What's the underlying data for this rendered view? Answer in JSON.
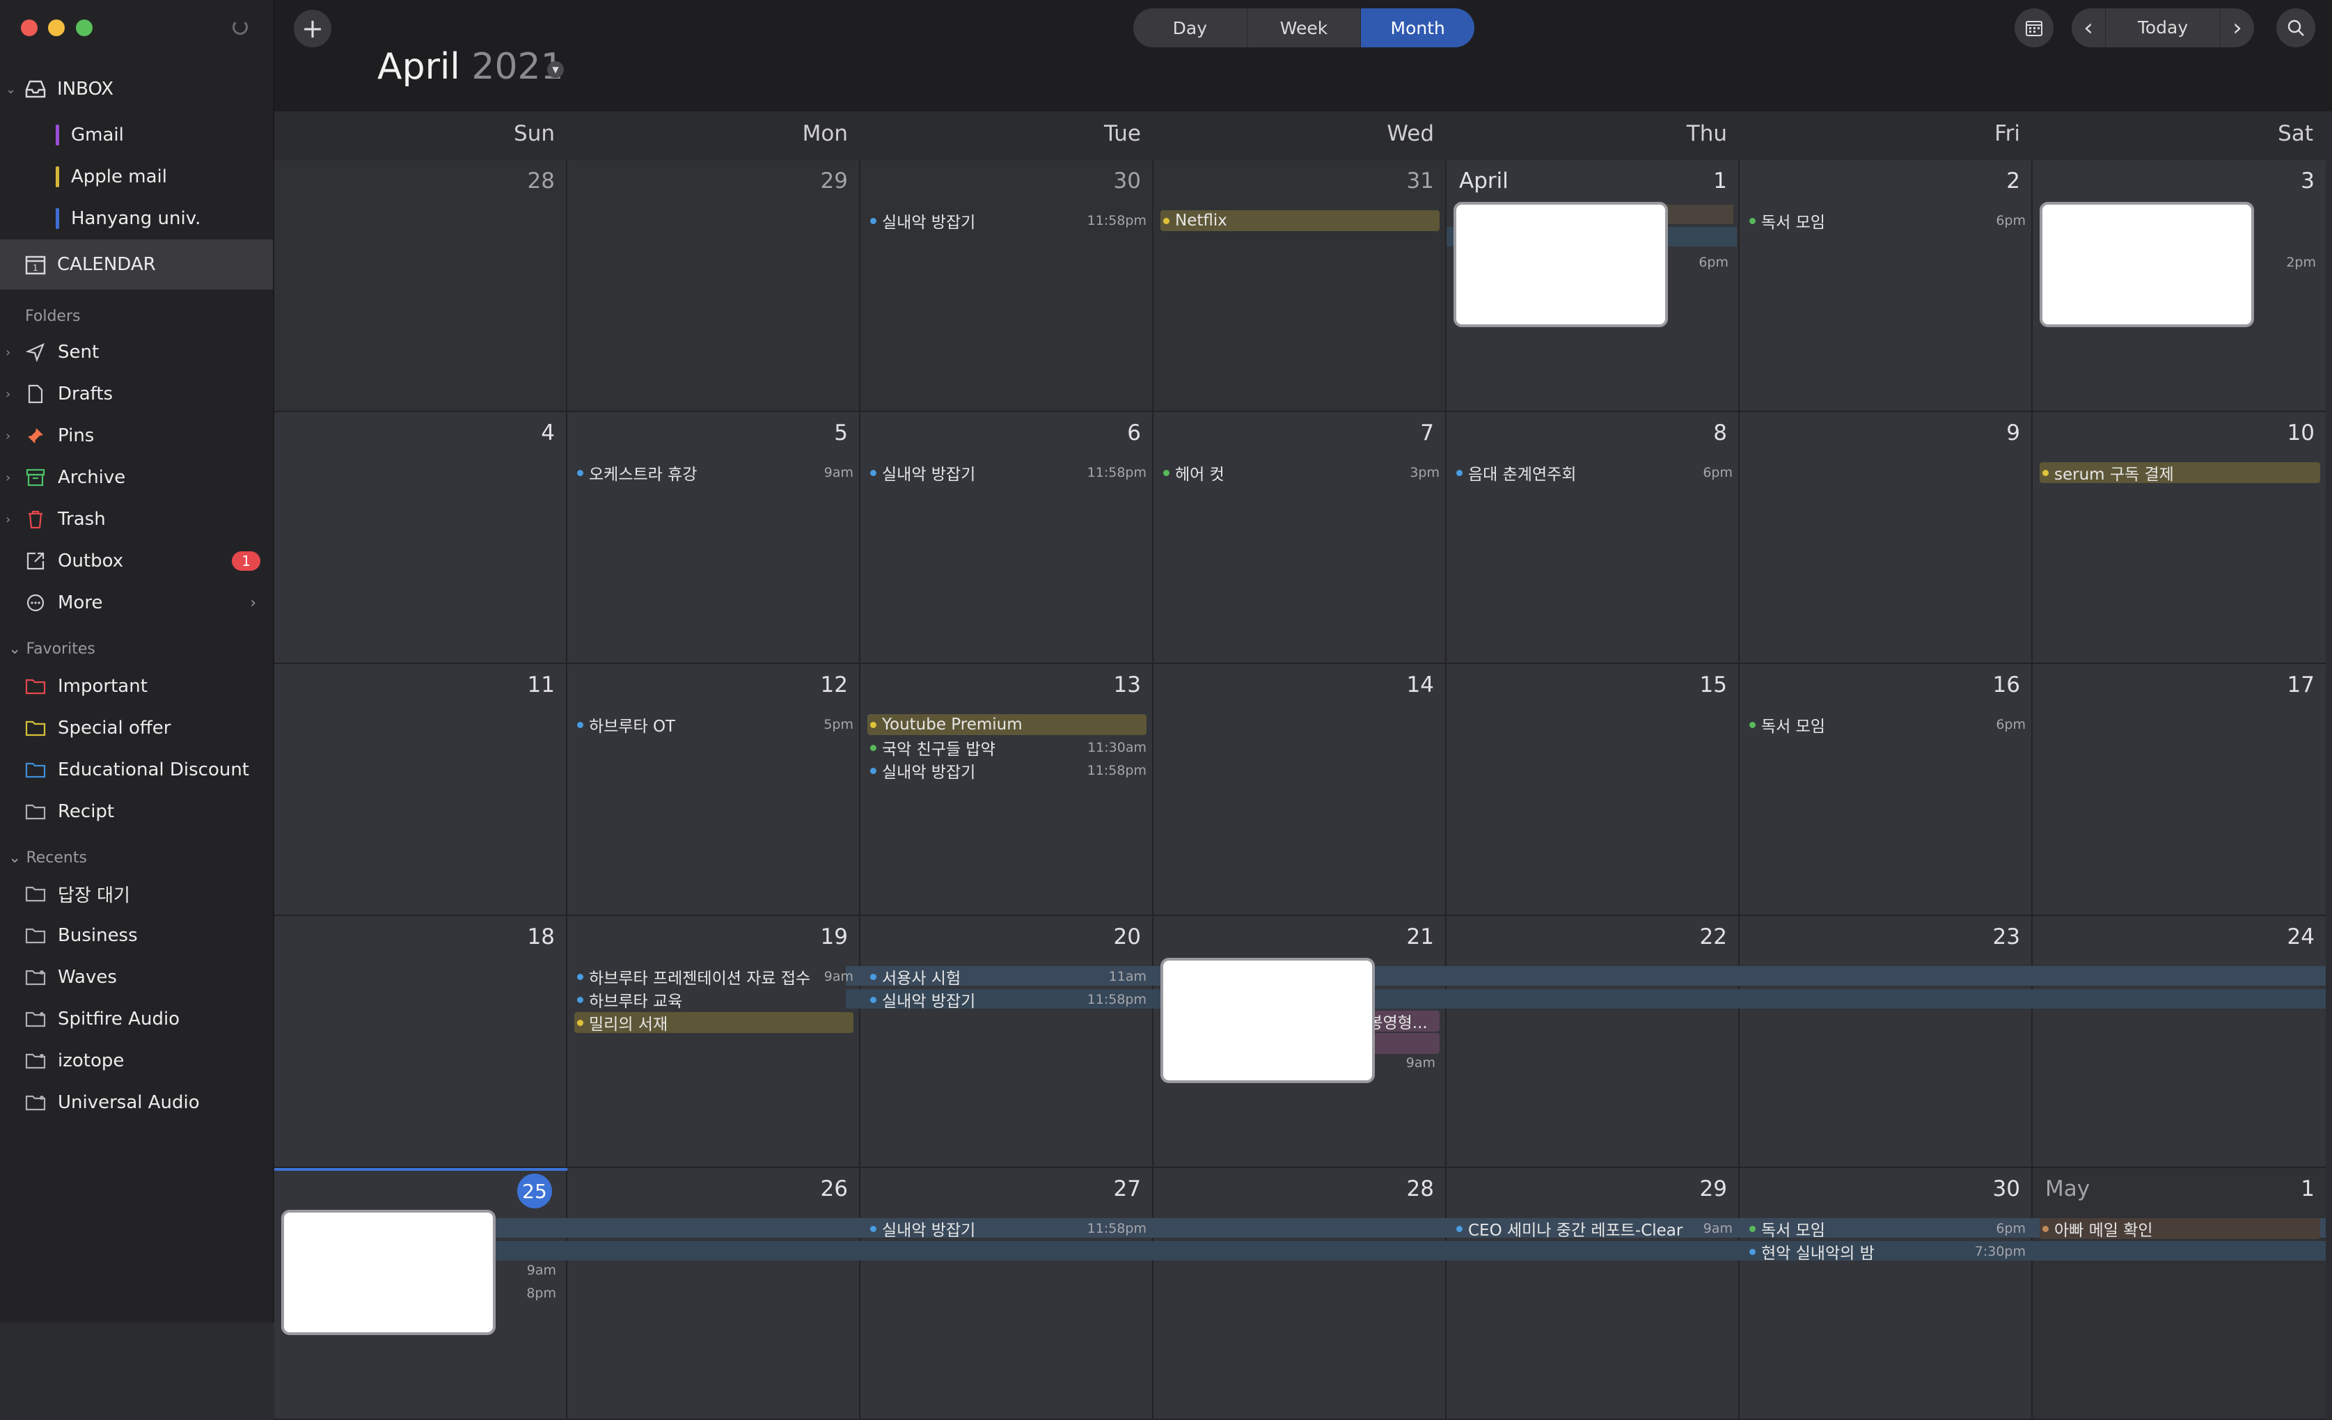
{
  "sidebar": {
    "inbox_label": "INBOX",
    "accounts": [
      {
        "label": "Gmail",
        "color": "#9b4fd6"
      },
      {
        "label": "Apple mail",
        "color": "#d6b73a"
      },
      {
        "label": "Hanyang univ.",
        "color": "#3f6fd6"
      }
    ],
    "calendar_label": "CALENDAR",
    "folders_header": "Folders",
    "folders": [
      {
        "label": "Sent",
        "icon": "paper-plane-icon"
      },
      {
        "label": "Drafts",
        "icon": "draft-document-icon"
      },
      {
        "label": "Pins",
        "icon": "pin-icon"
      },
      {
        "label": "Archive",
        "icon": "archive-box-icon"
      },
      {
        "label": "Trash",
        "icon": "trash-icon"
      },
      {
        "label": "Outbox",
        "icon": "outbox-icon",
        "badge": "1"
      },
      {
        "label": "More",
        "icon": "ellipsis-circle-icon"
      }
    ],
    "favorites_header": "Favorites",
    "favorites": [
      {
        "label": "Important",
        "color": "#e5484d"
      },
      {
        "label": "Special offer",
        "color": "#d6c23a"
      },
      {
        "label": "Educational Discount",
        "color": "#3f8ed6"
      },
      {
        "label": "Recipt",
        "color": "#b0b0b5"
      }
    ],
    "recents_header": "Recents",
    "recents": [
      {
        "label": "답장 대기"
      },
      {
        "label": "Business"
      },
      {
        "label": "Waves"
      },
      {
        "label": "Spitfire Audio"
      },
      {
        "label": "izotope"
      },
      {
        "label": "Universal Audio"
      }
    ]
  },
  "toolbar": {
    "add_label": "+",
    "views": [
      "Day",
      "Week",
      "Month"
    ],
    "active_view": "Month",
    "month": "April",
    "year": "2021",
    "today_label": "Today",
    "prev_label": "‹",
    "next_label": "›"
  },
  "calendar": {
    "weekdays": [
      "Sun",
      "Mon",
      "Tue",
      "Wed",
      "Thu",
      "Fri",
      "Sat"
    ],
    "weeks": [
      [
        {
          "num": "28",
          "other": true
        },
        {
          "num": "29",
          "other": true
        },
        {
          "num": "30",
          "other": true,
          "events": [
            {
              "title": "실내악 방잡기",
              "time": "11:58pm",
              "dot": "#4a9be0"
            }
          ]
        },
        {
          "num": "31",
          "other": true,
          "events": [
            {
              "title": "Netflix",
              "time": "",
              "dot": "#e0c23a",
              "bar": "olive"
            }
          ]
        },
        {
          "num": "1",
          "month_label": "April",
          "hidden": true,
          "time_only": "6pm"
        },
        {
          "num": "2",
          "events": [
            {
              "title": "독서 모임",
              "time": "6pm",
              "dot": "#5ab85a"
            }
          ]
        },
        {
          "num": "3",
          "hidden": true,
          "time_only": "2pm"
        }
      ],
      [
        {
          "num": "4"
        },
        {
          "num": "5",
          "events": [
            {
              "title": "오케스트라 휴강",
              "time": "9am",
              "dot": "#4a9be0"
            }
          ]
        },
        {
          "num": "6",
          "events": [
            {
              "title": "실내악 방잡기",
              "time": "11:58pm",
              "dot": "#4a9be0"
            }
          ]
        },
        {
          "num": "7",
          "events": [
            {
              "title": "헤어 컷",
              "time": "3pm",
              "dot": "#5ab85a"
            }
          ]
        },
        {
          "num": "8",
          "events": [
            {
              "title": "음대 춘계연주회",
              "time": "6pm",
              "dot": "#4a9be0"
            }
          ]
        },
        {
          "num": "9"
        },
        {
          "num": "10",
          "events": [
            {
              "title": "serum 구독 결제",
              "time": "",
              "dot": "#e0c23a",
              "bar": "olive"
            }
          ]
        }
      ],
      [
        {
          "num": "11"
        },
        {
          "num": "12",
          "events": [
            {
              "title": "하브루타 OT",
              "time": "5pm",
              "dot": "#4a9be0"
            }
          ]
        },
        {
          "num": "13",
          "events": [
            {
              "title": "Youtube Premium",
              "time": "",
              "dot": "#e0c23a",
              "bar": "olive"
            },
            {
              "title": "국악 친구들 밥약",
              "time": "11:30am",
              "dot": "#5ab85a"
            },
            {
              "title": "실내악 방잡기",
              "time": "11:58pm",
              "dot": "#4a9be0"
            }
          ]
        },
        {
          "num": "14"
        },
        {
          "num": "15"
        },
        {
          "num": "16",
          "events": [
            {
              "title": "독서 모임",
              "time": "6pm",
              "dot": "#5ab85a"
            }
          ]
        },
        {
          "num": "17"
        }
      ],
      [
        {
          "num": "18"
        },
        {
          "num": "19",
          "events": [
            {
              "title": "하브루타 프레젠테이션 자료 접수",
              "time": "9am",
              "dot": "#4a9be0"
            },
            {
              "title": "하브루타 교육",
              "time": "",
              "dot": "#4a9be0"
            },
            {
              "title": "밀리의 서재",
              "time": "",
              "dot": "#e0c23a",
              "bar": "olive"
            }
          ]
        },
        {
          "num": "20",
          "events": [
            {
              "title": "서용사 시험",
              "time": "11am",
              "dot": "#4a9be0"
            },
            {
              "title": "실내악 방잡기",
              "time": "11:58pm",
              "dot": "#4a9be0"
            }
          ]
        },
        {
          "num": "21",
          "hidden": true,
          "partial_event": "-봉영형...",
          "time_only": "9am"
        },
        {
          "num": "22"
        },
        {
          "num": "23"
        },
        {
          "num": "24"
        }
      ],
      [
        {
          "num": "25",
          "today": true,
          "hidden": true,
          "times": [
            "9am",
            "8pm"
          ]
        },
        {
          "num": "26"
        },
        {
          "num": "27",
          "events": [
            {
              "title": "실내악 방잡기",
              "time": "11:58pm",
              "dot": "#4a9be0"
            }
          ]
        },
        {
          "num": "28"
        },
        {
          "num": "29",
          "events": [
            {
              "title": "CEO 세미나 중간 레포트-Clear",
              "time": "9am",
              "dot": "#4a9be0"
            }
          ]
        },
        {
          "num": "30",
          "events": [
            {
              "title": "독서 모임",
              "time": "6pm",
              "dot": "#5ab85a"
            },
            {
              "title": "현악 실내악의 밤",
              "time": "7:30pm",
              "dot": "#4a9be0"
            }
          ]
        },
        {
          "num": "1",
          "month_label": "May",
          "other": true,
          "events": [
            {
              "title": "아빠 메일 확인",
              "time": "",
              "dot": "#c08a5a",
              "bar": "brown"
            }
          ]
        }
      ]
    ]
  }
}
